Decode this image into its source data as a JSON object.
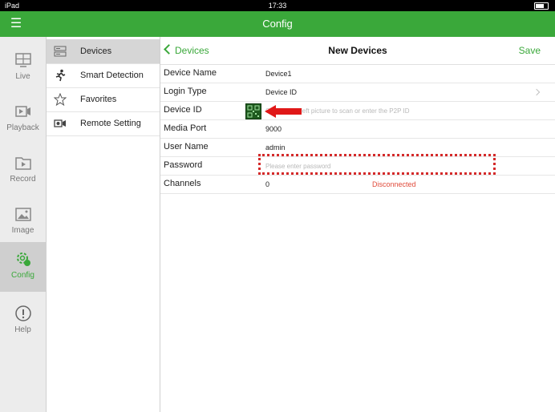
{
  "statusbar": {
    "device": "iPad",
    "time": "17:33"
  },
  "navbar": {
    "title": "Config"
  },
  "tabs": [
    {
      "label": "Live",
      "icon": "monitor-icon"
    },
    {
      "label": "Playback",
      "icon": "playback-icon"
    },
    {
      "label": "Record",
      "icon": "record-icon"
    },
    {
      "label": "Image",
      "icon": "image-icon"
    },
    {
      "label": "Config",
      "icon": "config-gear-icon",
      "active": true
    },
    {
      "label": "Help",
      "icon": "help-icon"
    }
  ],
  "submenu": [
    {
      "label": "Devices",
      "icon": "devices-icon",
      "active": true
    },
    {
      "label": "Smart Detection",
      "icon": "running-person-icon"
    },
    {
      "label": "Favorites",
      "icon": "star-icon"
    },
    {
      "label": "Remote Setting",
      "icon": "remote-setting-icon"
    }
  ],
  "detail": {
    "back_label": "Devices",
    "title": "New Devices",
    "save_label": "Save",
    "fields": {
      "device_name": {
        "label": "Device Name",
        "value": "Device1"
      },
      "login_type": {
        "label": "Login Type",
        "value": "Device ID"
      },
      "device_id": {
        "label": "Device ID",
        "placeholder": "Click on the left picture to scan or enter the P2P ID"
      },
      "media_port": {
        "label": "Media Port",
        "value": "9000"
      },
      "user_name": {
        "label": "User Name",
        "value": "admin"
      },
      "password": {
        "label": "Password",
        "placeholder": "Please enter password"
      },
      "channels": {
        "label": "Channels",
        "value": "0",
        "status": "Disconnected"
      }
    }
  },
  "colors": {
    "accent": "#3aa83a",
    "status_error": "#e04a3a",
    "highlight_box": "#d42a2a"
  }
}
